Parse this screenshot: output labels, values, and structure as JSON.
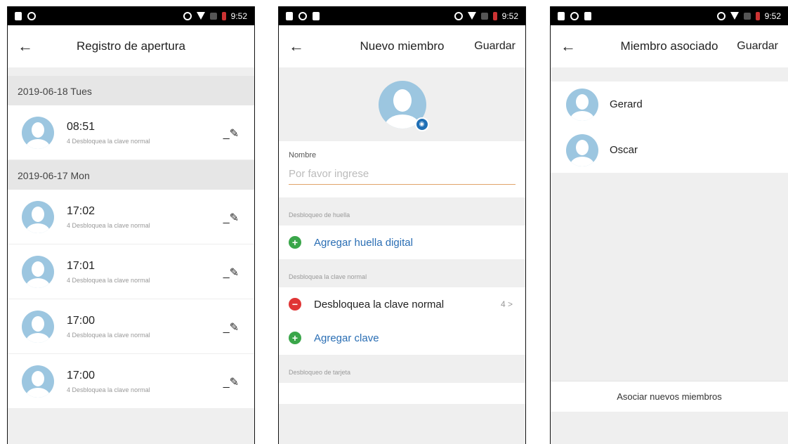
{
  "status": {
    "time": "9:52"
  },
  "screen1": {
    "title": "Registro de apertura",
    "groups": [
      {
        "date": "2019-06-18 Tues",
        "records": [
          {
            "time": "08:51",
            "sub": "4 Desbloquea la clave normal"
          }
        ]
      },
      {
        "date": "2019-06-17 Mon",
        "records": [
          {
            "time": "17:02",
            "sub": "4 Desbloquea la clave normal"
          },
          {
            "time": "17:01",
            "sub": "4 Desbloquea la clave normal"
          },
          {
            "time": "17:00",
            "sub": "4 Desbloquea la clave normal"
          },
          {
            "time": "17:00",
            "sub": "4 Desbloquea la clave normal"
          }
        ]
      }
    ]
  },
  "screen2": {
    "title": "Nuevo miembro",
    "save": "Guardar",
    "name_label": "Nombre",
    "name_placeholder": "Por favor ingrese",
    "fingerprint_section": "Desbloqueo de huella",
    "add_fingerprint": "Agregar huella digital",
    "password_section": "Desbloquea la clave normal",
    "password_item": "Desbloquea la clave normal",
    "password_count": "4 >",
    "add_password": "Agregar clave",
    "card_section": "Desbloqueo de tarjeta"
  },
  "screen3": {
    "title": "Miembro asociado",
    "save": "Guardar",
    "members": [
      "Gerard",
      "Oscar"
    ],
    "associate": "Asociar nuevos miembros"
  }
}
